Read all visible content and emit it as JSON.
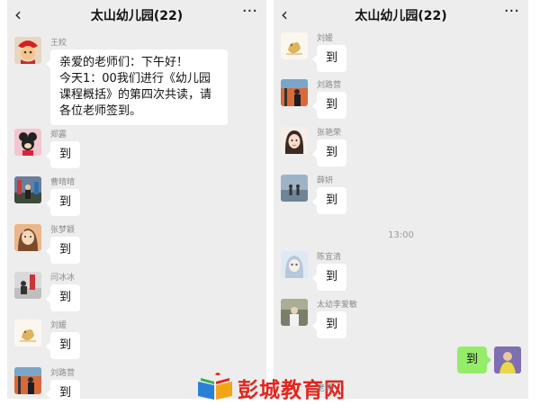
{
  "left": {
    "back_glyph": "‹",
    "title": "太山幼儿园(22)",
    "more_glyph": "···",
    "messages": [
      {
        "name": "王姣",
        "text": "亲爱的老师们：下午好！\n今天1：00我们进行《幼儿园课程概括》的第四次共读，请各位老师签到。"
      },
      {
        "name": "郑露",
        "text": "到"
      },
      {
        "name": "曹晴晴",
        "text": "到"
      },
      {
        "name": "张梦颖",
        "text": "到"
      },
      {
        "name": "闫冰冰",
        "text": "到"
      },
      {
        "name": "刘媛",
        "text": "到"
      },
      {
        "name": "刘路营",
        "text": "到"
      }
    ]
  },
  "right": {
    "back_glyph": "‹",
    "title": "太山幼儿园(22)",
    "more_glyph": "···",
    "messages": [
      {
        "name": "刘媛",
        "text": "到"
      },
      {
        "name": "刘路营",
        "text": "到"
      },
      {
        "name": "张艳荣",
        "text": "到"
      },
      {
        "name": "薛妍",
        "text": "到"
      }
    ],
    "timestamp": "13:00",
    "messages_after": [
      {
        "name": "陈宜清",
        "text": "到"
      },
      {
        "name": "太幼李爱敏",
        "text": "到"
      }
    ],
    "self_message": "到"
  },
  "watermark": {
    "text": "彭城教育网",
    "sub": "老师"
  },
  "colors": {
    "chat_bg": "#ededed",
    "self_bubble": "#95ec69",
    "watermark_red": "#e1261c"
  },
  "icons": [
    "back-arrow-icon",
    "more-icon",
    "book-logo-icon"
  ]
}
